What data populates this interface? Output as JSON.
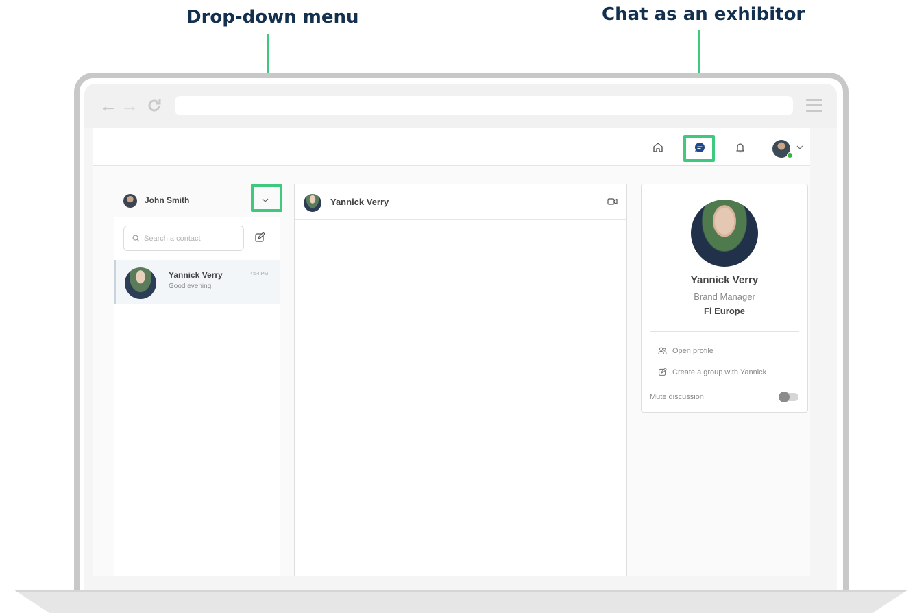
{
  "annotations": {
    "dropdown_title": "Drop-down menu",
    "chat_title": "Chat as an exhibitor"
  },
  "browser": {
    "back_icon": "arrow-left-icon",
    "forward_icon": "arrow-right-icon",
    "reload_icon": "reload-icon",
    "menu_icon": "hamburger-icon",
    "url": ""
  },
  "topbar": {
    "icons": [
      "home-icon",
      "chat-icon",
      "bell-icon",
      "user-avatar",
      "chevron-down-icon"
    ]
  },
  "left_panel": {
    "current_user": "John Smith",
    "search_placeholder": "Search a contact",
    "contacts": [
      {
        "name": "Yannick Verry",
        "last_message": "Good evening",
        "time": "4:54 PM"
      }
    ]
  },
  "conversation": {
    "contact_name": "Yannick Verry"
  },
  "profile": {
    "name": "Yannick Verry",
    "role": "Brand Manager",
    "company": "Fi Europe",
    "open_profile_label": "Open profile",
    "create_group_label": "Create a group with Yannick",
    "mute_label": "Mute discussion",
    "mute_on": false
  },
  "colors": {
    "highlight": "#3ec97e",
    "title_text": "#14304f",
    "chat_icon": "#1c4a8a"
  }
}
